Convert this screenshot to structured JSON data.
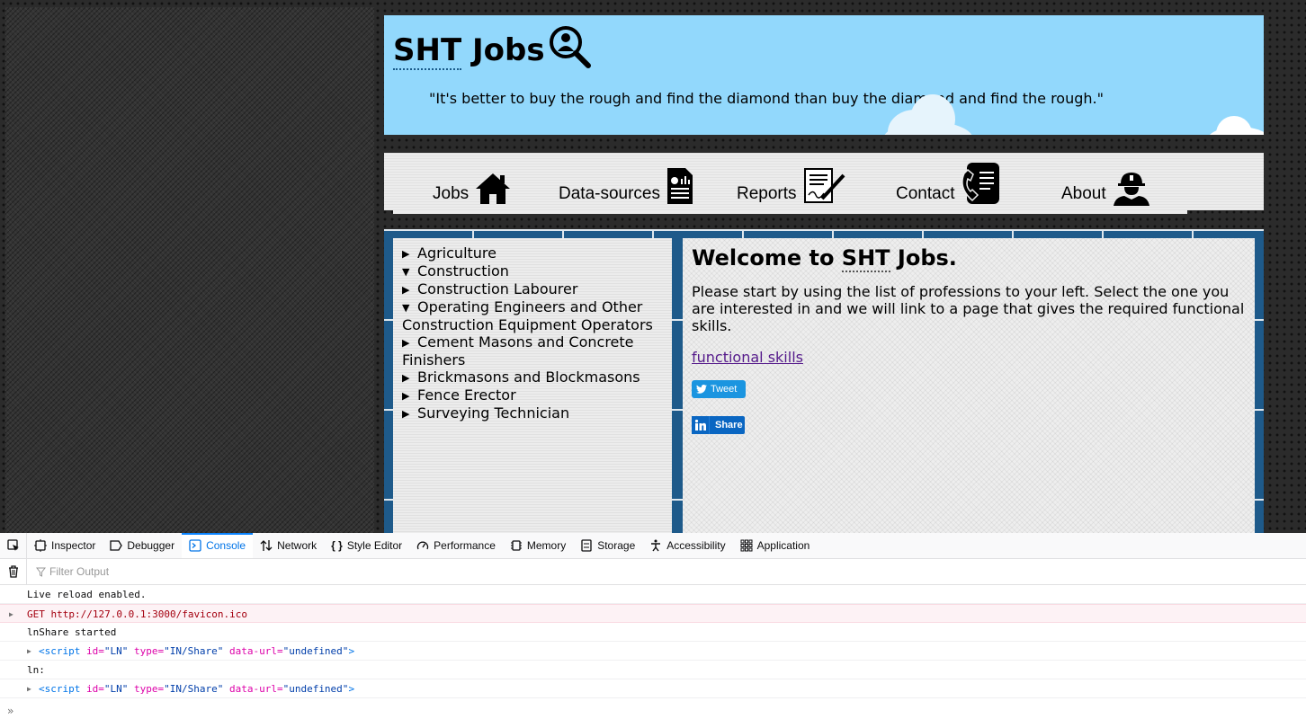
{
  "site": {
    "brand_prefix": "SHT",
    "brand_suffix": " Jobs",
    "quote": "\"It's better to buy the rough and find the diamond than buy the diamond and find the rough.\""
  },
  "nav": {
    "items": [
      {
        "label": "Jobs",
        "icon": "home-icon"
      },
      {
        "label": "Data-sources",
        "icon": "report-document-icon"
      },
      {
        "label": "Reports",
        "icon": "signed-document-icon"
      },
      {
        "label": "Contact",
        "icon": "phone-contact-icon"
      },
      {
        "label": "About",
        "icon": "worker-icon"
      }
    ]
  },
  "sidebar": {
    "items": [
      {
        "label": "Agriculture",
        "expanded": false
      },
      {
        "label": "Construction",
        "expanded": true
      },
      {
        "label": "Construction Labourer",
        "expanded": false
      },
      {
        "label": "Operating Engineers and Other Construction Equipment Operators",
        "expanded": true
      },
      {
        "label": "Cement Masons and Concrete Finishers",
        "expanded": false
      },
      {
        "label": "Brickmasons and Blockmasons",
        "expanded": false
      },
      {
        "label": "Fence Erector",
        "expanded": false
      },
      {
        "label": "Surveying Technician",
        "expanded": false
      }
    ]
  },
  "main": {
    "welcome_prefix": "Welcome to ",
    "welcome_abbr": "SHT",
    "welcome_suffix": " Jobs.",
    "intro": "Please start by using the list of professions to your left. Select the one you are interested in and we will link to a page that gives the required functional skills.",
    "link_text": "functional skills",
    "tweet_label": "Tweet",
    "share_label": "Share"
  },
  "devtools": {
    "tabs": [
      {
        "label": "Inspector",
        "icon": "inspector-icon",
        "active": false
      },
      {
        "label": "Debugger",
        "icon": "debugger-icon",
        "active": false
      },
      {
        "label": "Console",
        "icon": "console-icon",
        "active": true
      },
      {
        "label": "Network",
        "icon": "network-icon",
        "active": false
      },
      {
        "label": "Style Editor",
        "icon": "style-editor-icon",
        "active": false
      },
      {
        "label": "Performance",
        "icon": "performance-icon",
        "active": false
      },
      {
        "label": "Memory",
        "icon": "memory-icon",
        "active": false
      },
      {
        "label": "Storage",
        "icon": "storage-icon",
        "active": false
      },
      {
        "label": "Accessibility",
        "icon": "accessibility-icon",
        "active": false
      },
      {
        "label": "Application",
        "icon": "application-icon",
        "active": false
      }
    ],
    "filter_placeholder": "Filter Output",
    "logs": {
      "live_reload": "Live reload enabled.",
      "get_method": "GET",
      "get_url": "http://127.0.0.1:3000/favicon.ico",
      "lnshare": "lnShare started",
      "ln_label": "ln:",
      "script_tag_open": "<script",
      "attr_id": "id=",
      "val_id": "\"LN\"",
      "attr_type": "type=",
      "val_type": "\"IN/Share\"",
      "attr_data_url": "data-url=",
      "val_data_url": "\"undefined\"",
      "tag_close": ">"
    },
    "prompt": "»"
  },
  "colors": {
    "header_bg": "#92d8fc",
    "frame_blue": "#1e5a8a",
    "link_visited": "#551a8b",
    "tweet_blue": "#1b95e0",
    "linkedin_blue": "#0a66c2",
    "console_active": "#0a84ff",
    "error_red": "#a4000f"
  }
}
